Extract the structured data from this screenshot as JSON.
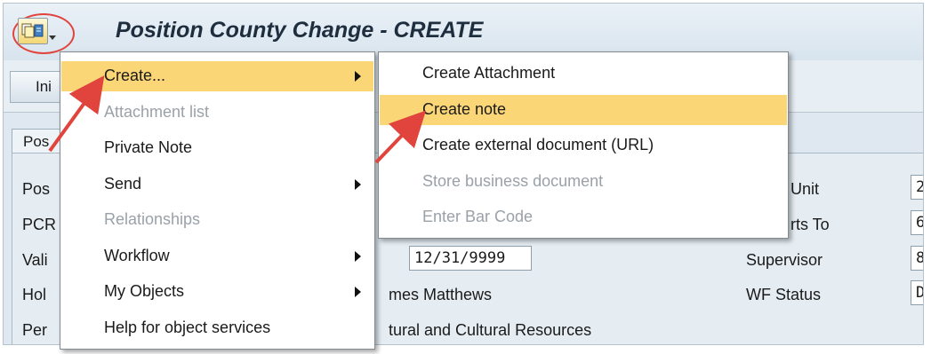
{
  "window": {
    "title": "Position County Change - CREATE",
    "gos_icon": "generic-object-services-icon"
  },
  "toolbar": {
    "button_label": "Ini"
  },
  "tabs": [
    {
      "label": "Pos"
    }
  ],
  "form": {
    "left_labels": [
      "Pos",
      "PCR",
      "Vali",
      "Hol",
      "Per"
    ],
    "valid_to": "12/31/9999",
    "holder_name": "mes Matthews",
    "personnel_area": "tural and Cultural Resources",
    "right_fields": [
      {
        "label": "Unit",
        "value": "2"
      },
      {
        "label": "rts To",
        "value": "6."
      },
      {
        "label": "Supervisor",
        "value": "8"
      },
      {
        "label": "WF Status",
        "value": "D"
      }
    ]
  },
  "menu": {
    "items": [
      {
        "label": "Create...",
        "enabled": true,
        "submenu": true,
        "highlighted": true
      },
      {
        "label": "Attachment list",
        "enabled": false,
        "submenu": false
      },
      {
        "label": "Private Note",
        "enabled": true,
        "submenu": false
      },
      {
        "label": "Send",
        "enabled": true,
        "submenu": true
      },
      {
        "label": "Relationships",
        "enabled": false,
        "submenu": false
      },
      {
        "label": "Workflow",
        "enabled": true,
        "submenu": true
      },
      {
        "label": "My Objects",
        "enabled": true,
        "submenu": true
      },
      {
        "label": "Help for object services",
        "enabled": true,
        "submenu": false
      }
    ]
  },
  "submenu": {
    "items": [
      {
        "label": "Create Attachment",
        "enabled": true
      },
      {
        "label": "Create note",
        "enabled": true,
        "highlighted": true
      },
      {
        "label": "Create external document (URL)",
        "enabled": true
      },
      {
        "label": "Store business document",
        "enabled": false
      },
      {
        "label": "Enter Bar Code",
        "enabled": false
      }
    ]
  },
  "colors": {
    "highlight": "#fbd677",
    "annotation_red": "#e0443c",
    "title_text": "#1e2e3e"
  }
}
